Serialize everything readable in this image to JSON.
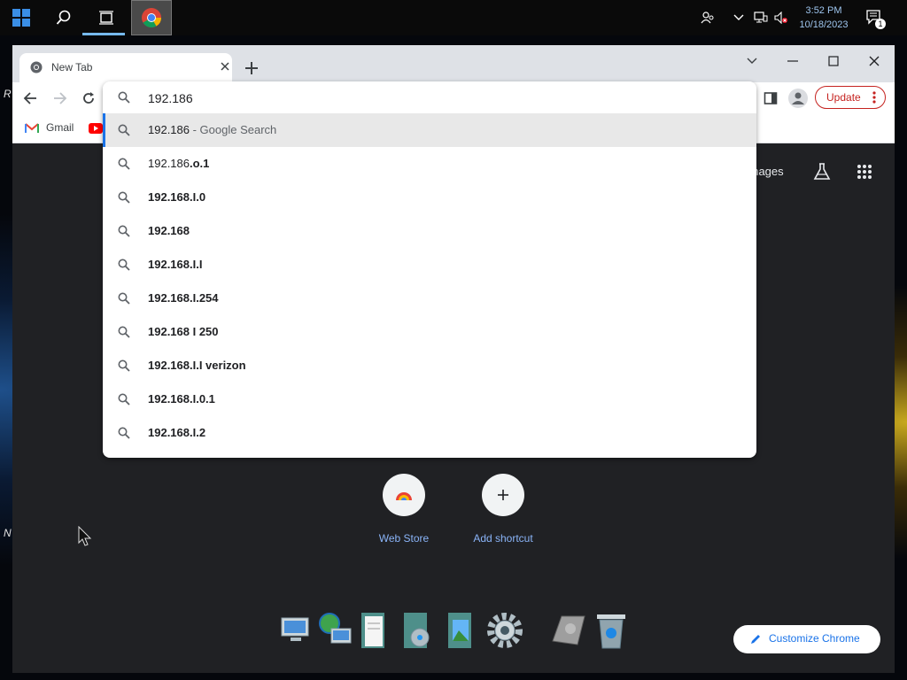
{
  "taskbar": {
    "clock_time": "3:52 PM",
    "clock_date": "10/18/2023",
    "notification_count": "1"
  },
  "desktop": {
    "letters": [
      "R",
      "N"
    ]
  },
  "browser": {
    "tab_title": "New Tab",
    "update_label": "Update",
    "bookmarks": [
      {
        "label": "Gmail"
      }
    ]
  },
  "omnibox": {
    "input_value": "192.186",
    "suggestions": [
      {
        "typed": "192.186",
        "rest": "",
        "suffix": " - Google Search",
        "bold_rest": false
      },
      {
        "typed": "192.186",
        "rest": ".o.1",
        "suffix": "",
        "bold_rest": true
      },
      {
        "typed": "",
        "rest": "192.168.I.0",
        "suffix": "",
        "bold_rest": true
      },
      {
        "typed": "",
        "rest": "192.168",
        "suffix": "",
        "bold_rest": true
      },
      {
        "typed": "",
        "rest": "192.168.I.I",
        "suffix": "",
        "bold_rest": true
      },
      {
        "typed": "",
        "rest": "192.168.I.254",
        "suffix": "",
        "bold_rest": true
      },
      {
        "typed": "",
        "rest": "192.168 I 250",
        "suffix": "",
        "bold_rest": true
      },
      {
        "typed": "",
        "rest": "192.168.I.I verizon",
        "suffix": "",
        "bold_rest": true
      },
      {
        "typed": "",
        "rest": "192.168.I.0.1",
        "suffix": "",
        "bold_rest": true
      },
      {
        "typed": "",
        "rest": "192.168.I.2",
        "suffix": "",
        "bold_rest": true
      }
    ]
  },
  "ntp": {
    "images_label": "Images",
    "shortcuts": [
      {
        "label": "Web Store"
      },
      {
        "label": "Add shortcut"
      }
    ],
    "customize_label": "Customize Chrome"
  },
  "colors": {
    "accent": "#1a73e8",
    "update_red": "#c5221f",
    "link_blue": "#8ab4f8"
  }
}
